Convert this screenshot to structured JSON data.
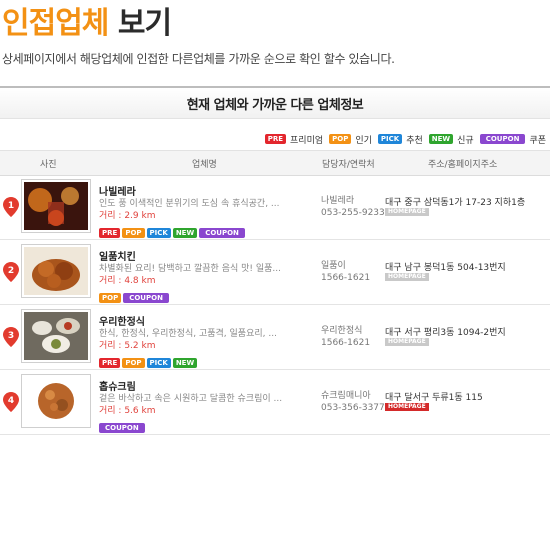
{
  "page": {
    "title_part1": "인접업체",
    "title_part2": " 보기",
    "subtitle": "상세페이지에서 해당업체에 인접한 다른업체를 가까운 순으로 확인 할수 있습니다."
  },
  "panel": {
    "heading": "현재 업체와 가까운 다른 업체정보",
    "legend": [
      {
        "badge": "PRE",
        "label": "프리미엄",
        "color": "#e3262d"
      },
      {
        "badge": "POP",
        "label": "인기",
        "color": "#f39114"
      },
      {
        "badge": "PICK",
        "label": "추천",
        "color": "#1f86d9"
      },
      {
        "badge": "NEW",
        "label": "신규",
        "color": "#2fa52e"
      },
      {
        "badge": "COUPON",
        "label": "쿠폰",
        "color": "#8a47cf"
      }
    ]
  },
  "table": {
    "headers": {
      "photo": "사진",
      "name": "업체명",
      "contact": "담당자/연락처",
      "address": "주소/홈페이지주소"
    },
    "rows": [
      {
        "num": "1",
        "name": "나빌레라",
        "desc": "인도 풍 이색적인 분위기의 도심 속 휴식공간, ...",
        "distance": "거리 : 2.9 km",
        "badges": [
          "PRE",
          "POP",
          "PICK",
          "NEW",
          "COUPON"
        ],
        "contact_name": "나빌레라",
        "phone": "053-255-9233",
        "address": "대구 중구 삼덕동1가 17-23 지하1층",
        "homepage": "HOMEPAGE",
        "homepage_active": false
      },
      {
        "num": "2",
        "name": "일품치킨",
        "desc": "차별화된 요리! 담백하고 깔끔한 음식 맛! 일품...",
        "distance": "거리 : 4.8 km",
        "badges": [
          "POP",
          "COUPON"
        ],
        "contact_name": "일품이",
        "phone": "1566-1621",
        "address": "대구 남구 봉덕1동 504-13번지",
        "homepage": "HOMEPAGE",
        "homepage_active": false
      },
      {
        "num": "3",
        "name": "우리한정식",
        "desc": "한식, 한정식, 우리한정식, 고품격, 일품요리, ...",
        "distance": "거리 : 5.2 km",
        "badges": [
          "PRE",
          "POP",
          "PICK",
          "NEW"
        ],
        "contact_name": "우리한정식",
        "phone": "1566-1621",
        "address": "대구 서구 평리3동 1094-2번지",
        "homepage": "HOMEPAGE",
        "homepage_active": false
      },
      {
        "num": "4",
        "name": "홉슈크림",
        "desc": "겉은 바삭하고 속은 시원하고 달콤한 슈크림이 ...",
        "distance": "거리 : 5.6 km",
        "badges": [
          "COUPON"
        ],
        "contact_name": "슈크림매니아",
        "phone": "053-356-3377",
        "address": "대구 달서구 두류1동 115",
        "homepage": "HOMEPAGE",
        "homepage_active": true
      }
    ]
  }
}
